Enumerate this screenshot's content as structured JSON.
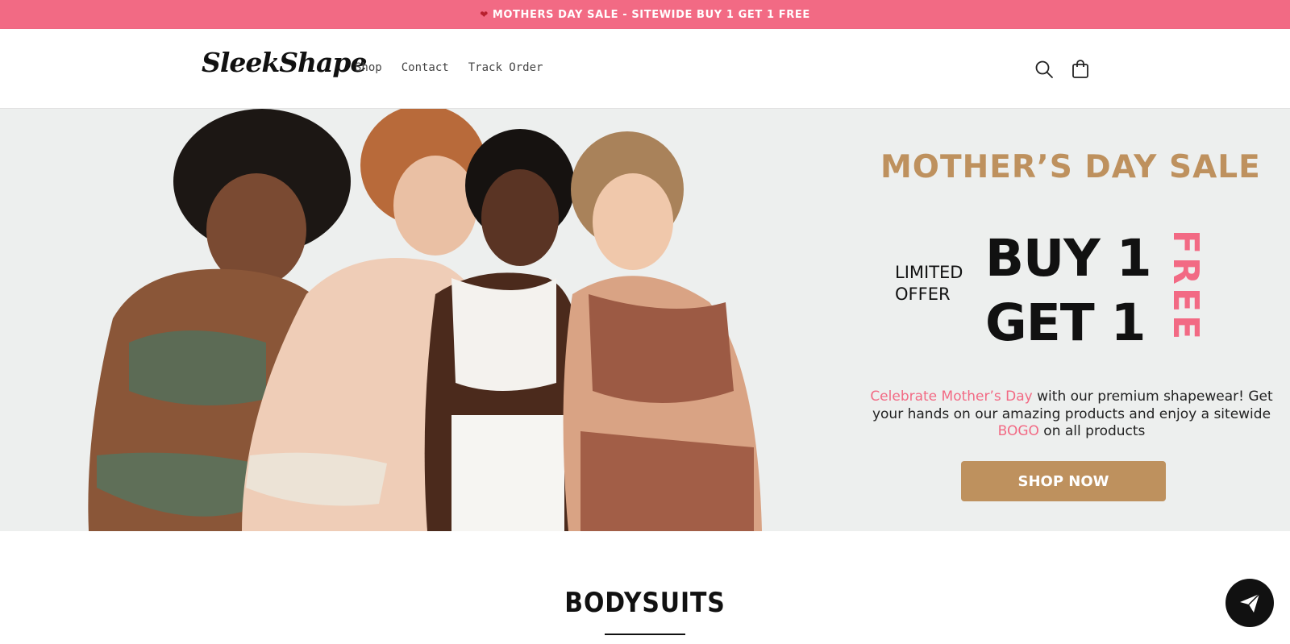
{
  "announcement": {
    "icon": "hearts-icon",
    "text": "MOTHERS DAY SALE - SITEWIDE BUY 1 GET 1 FREE"
  },
  "header": {
    "logo_text": "SleekShape",
    "nav": [
      "Shop",
      "Contact",
      "Track Order"
    ],
    "icons": [
      "search-icon",
      "cart-icon"
    ]
  },
  "hero": {
    "title": "MOTHER’S DAY SALE",
    "limited_line1": "LIMITED",
    "limited_line2": "OFFER",
    "bogo_line1": "BUY 1",
    "bogo_line2": "GET 1",
    "free": "FREE",
    "text_highlight": "Celebrate Mother’s Day",
    "text_part1": " with our premium shapewear! Get your hands on our amazing products and enjoy a sitewide ",
    "text_bogo": "BOGO",
    "text_part2": " on all products",
    "cta": "SHOP NOW"
  },
  "section": {
    "title": "BODYSUITS"
  },
  "chat_fab": {
    "icon": "send-icon"
  },
  "colors": {
    "announcement_bg": "#f26a84",
    "accent_gold": "#be915e",
    "accent_pink": "#f26a84",
    "hero_bg": "#edefee"
  }
}
